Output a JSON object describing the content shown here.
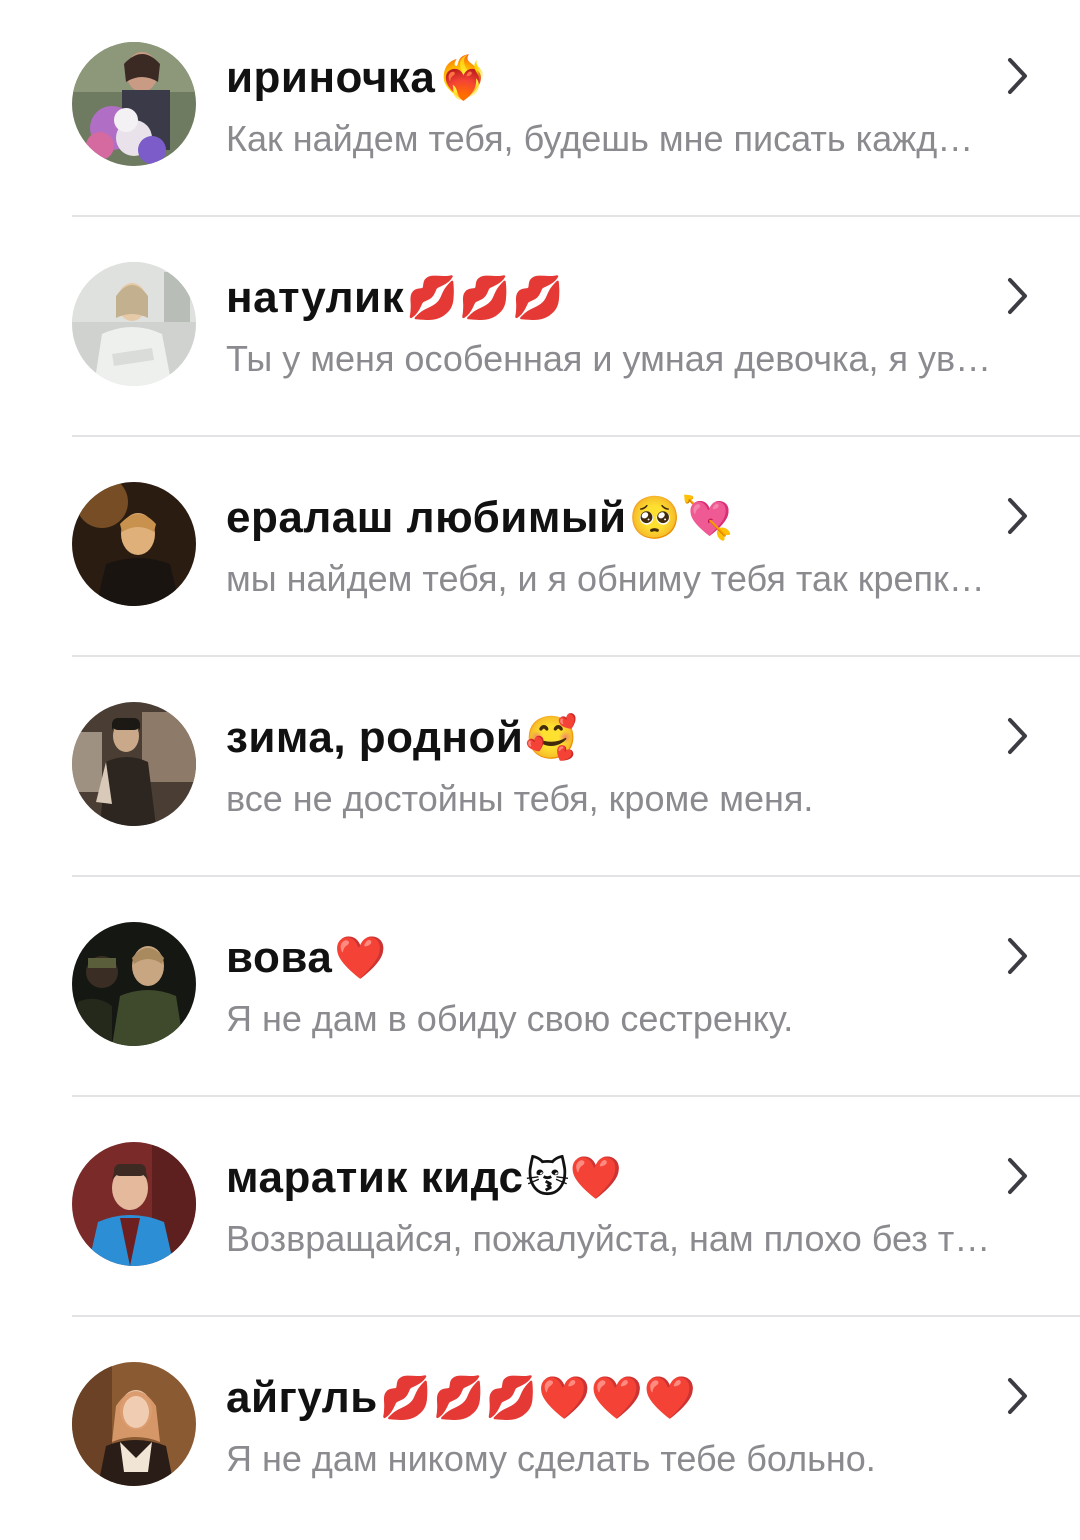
{
  "chats": [
    {
      "name": "ириночка",
      "emoji": "❤️‍🔥",
      "preview": "Как найдем тебя, будешь мне писать кажд…",
      "avatar_icon": "avatar-bouquet-photo",
      "avatar_colors": [
        "#6f7b61",
        "#b06fc4",
        "#e9e2ea",
        "#3b3a48"
      ]
    },
    {
      "name": "натулик",
      "emoji": "💋💋💋",
      "preview": "Ты у меня особенная и умная девочка, я ув…",
      "avatar_icon": "avatar-nurse-photo",
      "avatar_colors": [
        "#cfd2cf",
        "#eef0ee",
        "#e6c9a6",
        "#c3b08f"
      ]
    },
    {
      "name": "ералаш любимый",
      "emoji": "🥺💘",
      "preview": "мы найдем тебя, и я обниму тебя так крепк…",
      "avatar_icon": "avatar-dark-portrait-photo",
      "avatar_colors": [
        "#2b1c12",
        "#8a5a2b",
        "#e0b07a",
        "#1a1410"
      ]
    },
    {
      "name": "зима, родной",
      "emoji": "🥰",
      "preview": "все не достойны тебя, кроме меня.",
      "avatar_icon": "avatar-sitting-man-photo",
      "avatar_colors": [
        "#4a3d33",
        "#d8c9b8",
        "#2c2520",
        "#8d7a68"
      ]
    },
    {
      "name": "вова",
      "emoji": "❤️",
      "preview": "Я не дам в обиду свою сестренку.",
      "avatar_icon": "avatar-night-street-photo",
      "avatar_colors": [
        "#151812",
        "#3f4a2c",
        "#c9a682",
        "#5a5e3a"
      ]
    },
    {
      "name": "маратик кидс",
      "emoji": "😽❤️",
      "preview": "Возвращайся, пожалуйста, нам плохо без т…",
      "avatar_icon": "avatar-blue-jacket-photo",
      "avatar_colors": [
        "#7b2a2a",
        "#2c8fd6",
        "#e4b99c",
        "#3d2a22"
      ]
    },
    {
      "name": "айгуль",
      "emoji": "💋💋💋❤️❤️❤️",
      "preview": "Я не дам никому сделать тебе больно.",
      "avatar_icon": "avatar-school-girl-photo",
      "avatar_colors": [
        "#8a5a33",
        "#f1e6d6",
        "#d99a6c",
        "#2a1c16"
      ]
    }
  ],
  "chevron_icon": "chevron-right-icon",
  "colors": {
    "name": "#111111",
    "preview": "#8a8a8f",
    "divider": "#e3e3e6",
    "chevron": "#3c3c43"
  }
}
